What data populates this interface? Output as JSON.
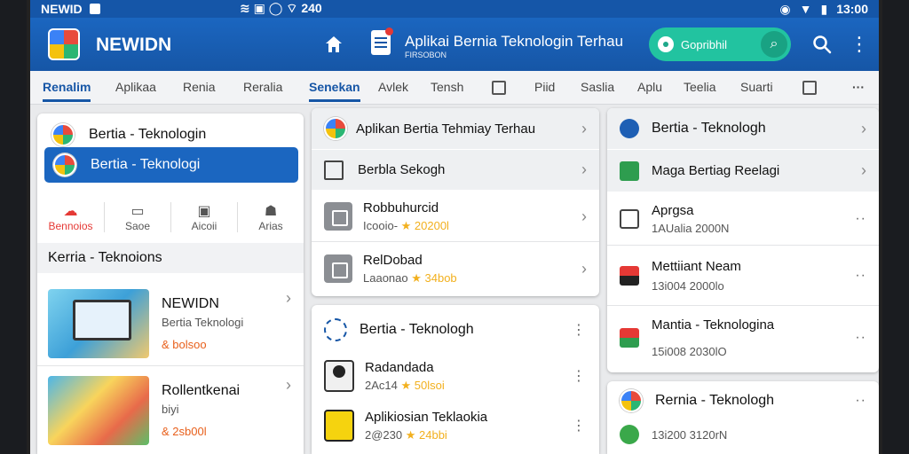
{
  "status": {
    "brand": "NEWID",
    "center": "≋ ▣ ◯ ⌔ 240",
    "time": "13:00"
  },
  "header": {
    "app_name": "NEWIDN",
    "title": "Aplikai Bernia Teknologin Terhau",
    "subtitle": "FIRSOBON",
    "pill_label": "Gopribhil"
  },
  "tabs": [
    "Renalim",
    "Aplikaa",
    "Renia",
    "Reralia",
    "Senekan",
    "Avlek",
    "Tensh",
    "Piid",
    "Saslia",
    "Aplu",
    "Teelia",
    "Suarti"
  ],
  "colors": {
    "primary": "#1656a6",
    "accent": "#22c3a0",
    "star": "#f2b01e"
  },
  "col1": {
    "top": "Bertia - Teknologin",
    "selected": "Bertia - Teknologi",
    "tools": [
      "Bennoios",
      "Saoe",
      "Aicoii",
      "Arias"
    ],
    "section": "Kerria - Teknoions",
    "items": [
      {
        "title": "NEWIDN",
        "sub": "Bertia Teknologi",
        "price": "& bolsoo"
      },
      {
        "title": "Rollentkenai",
        "sub": "biyi",
        "price": "& 2sb00l"
      }
    ]
  },
  "col2": {
    "list": [
      {
        "title": "Aplikan Bertia Tehmiay Terhau"
      },
      {
        "title": "Berbla Sekogh"
      },
      {
        "title": "Robbuhurcid",
        "meta": "Icooio- ",
        "rating": "★ 20200l"
      },
      {
        "title": "RelDobad",
        "meta": "Laaonao ",
        "rating": "★ 34bob"
      }
    ],
    "section": "Bertia - Teknologh",
    "items": [
      {
        "title": "Radandada",
        "meta": "2Ac14 ",
        "rating": "★ 50lsoi"
      },
      {
        "title": "Aplikiosian Teklaokia",
        "meta": "2@230 ",
        "rating": "★ 24bbi"
      }
    ]
  },
  "col3": {
    "list": [
      {
        "title": "Bertia - Teknologh"
      },
      {
        "title": "Maga Bertiag Reelagi"
      },
      {
        "title": "Aprgsa",
        "meta": "1AUalia 2000N"
      },
      {
        "title": "Mettiiant Neam",
        "meta": "13i004 2000lo"
      },
      {
        "title": "Mantia - Teknologina",
        "meta": "15i008 2030lO"
      }
    ],
    "section": {
      "title": "Rernia - Teknologh",
      "meta": "13i200 3120rN"
    }
  }
}
